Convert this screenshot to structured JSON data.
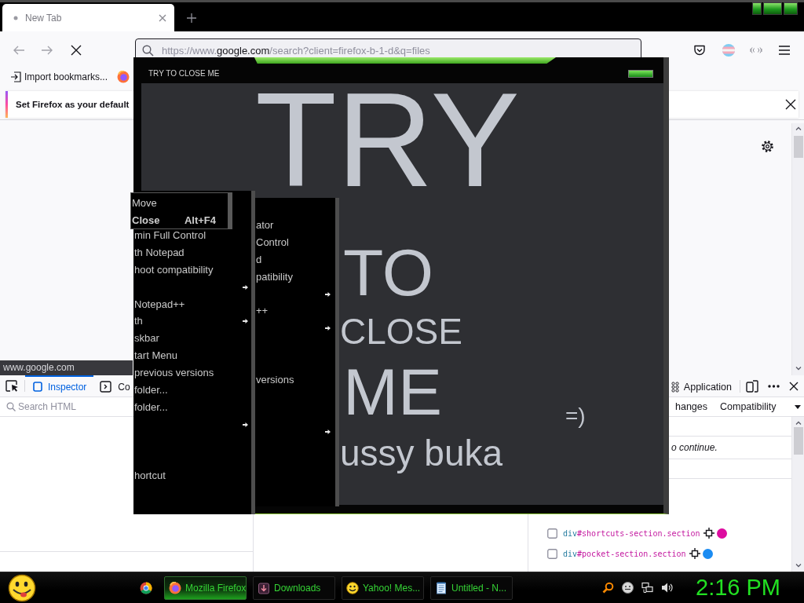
{
  "browser": {
    "tabs": [
      {
        "label": "New Tab",
        "selected": true
      }
    ],
    "address_bar": {
      "scheme": "https://www.",
      "domain": "google.com",
      "path": "/search?client=firefox-b-1-d&q=files"
    },
    "bookmarks": [
      {
        "label": "Import bookmarks..."
      }
    ],
    "notification": {
      "message": "Set Firefox as your default"
    },
    "status_url": "www.google.com"
  },
  "devtools": {
    "tools": [
      {
        "label": "Inspector",
        "selected": true
      },
      {
        "label": "Co",
        "selected": false
      }
    ],
    "more_tools": [
      {
        "label": "Application",
        "selected": false
      }
    ],
    "search": {
      "placeholder": "Search HTML"
    },
    "sidebar_tabs": [
      {
        "label": "hanges",
        "selected": false
      },
      {
        "label": "Compatibility",
        "selected": false
      }
    ],
    "notice": "o continue.",
    "containers": [
      {
        "tag": "div",
        "selector": "#shortcuts-section.section",
        "checked": false,
        "color": "#dd0ca0"
      },
      {
        "tag": "div",
        "selector": "#pocket-section.section",
        "checked": false,
        "color": "#1b8cf2"
      }
    ]
  },
  "popup": {
    "title": "TRY TO CLOSE ME",
    "lines": [
      {
        "text": "TRY",
        "kind": "huge"
      },
      {
        "text": "TO",
        "kind": "large"
      },
      {
        "text": "CLOSE",
        "kind": "medium"
      },
      {
        "text": "ME",
        "kind": "large"
      },
      {
        "text": "ussy buka",
        "kind": "medium"
      }
    ],
    "note": "=)"
  },
  "system_menu": {
    "items": [
      {
        "label": "Move",
        "default": false
      },
      {
        "label": "Close",
        "shortcut": "Alt+F4",
        "default": true
      }
    ]
  },
  "context_menus": [
    {
      "items": [
        {
          "label": "min Full Control",
          "submenu": false
        },
        {
          "label": "th Notepad",
          "submenu": false
        },
        {
          "label": "hoot compatibility",
          "submenu": false
        },
        {
          "submenu": true
        },
        {
          "label": "Notepad++",
          "submenu": false
        },
        {
          "label": "th",
          "submenu": true
        },
        {
          "label": "skbar",
          "submenu": false
        },
        {
          "label": "tart Menu",
          "submenu": false
        },
        {
          "label": "previous versions",
          "submenu": false
        },
        {
          "label": "folder...",
          "submenu": false
        },
        {
          "label": "folder...",
          "submenu": false
        },
        {
          "submenu": true
        },
        {
          "submenu": false
        },
        {
          "submenu": false
        },
        {
          "label": "hortcut",
          "submenu": false
        }
      ]
    },
    {
      "items": [
        {
          "label": "ator",
          "submenu": false
        },
        {
          "label": "Control",
          "submenu": false
        },
        {
          "label": "d",
          "submenu": false
        },
        {
          "label": "patibility",
          "submenu": false
        },
        {
          "submenu": true
        },
        {
          "label": "++",
          "submenu": false
        },
        {
          "submenu": true
        },
        {
          "submenu": false
        },
        {
          "submenu": false
        },
        {
          "label": "versions",
          "submenu": false
        },
        {
          "submenu": false
        },
        {
          "submenu": false
        },
        {
          "submenu": true
        }
      ]
    }
  ],
  "taskbar": {
    "tasks": [
      {
        "label": "Mozilla Firefox",
        "selected": true
      },
      {
        "label": "Downloads",
        "selected": false
      },
      {
        "label": "Yahoo! Mes...",
        "selected": false
      },
      {
        "label": "Untitled - N...",
        "selected": false
      }
    ],
    "clock": "2:16 PM"
  }
}
